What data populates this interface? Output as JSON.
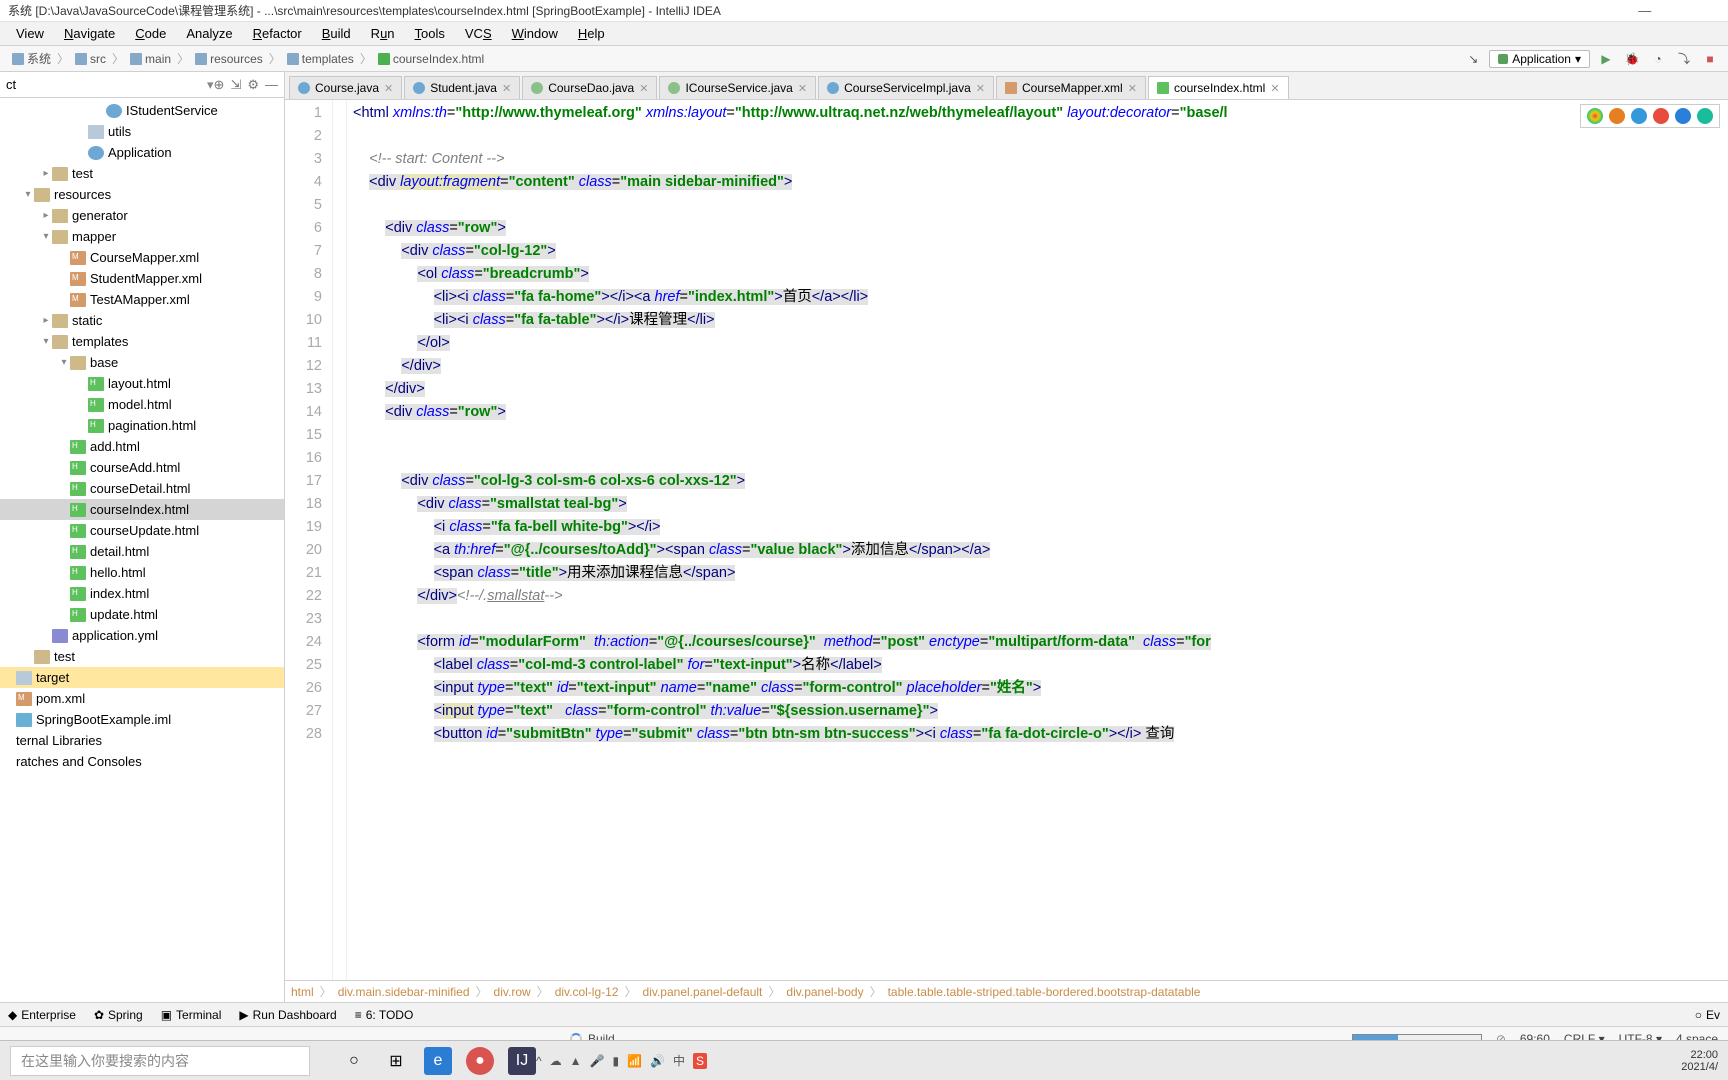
{
  "window": {
    "title": "系统 [D:\\Java\\JavaSourceCode\\课程管理系统] - ...\\src\\main\\resources\\templates\\courseIndex.html [SpringBootExample] - IntelliJ IDEA"
  },
  "menu": {
    "view": "View",
    "navigate": "Navigate",
    "code": "Code",
    "analyze": "Analyze",
    "refactor": "Refactor",
    "build": "Build",
    "run": "Run",
    "tools": "Tools",
    "vcs": "VCS",
    "window": "Window",
    "help": "Help"
  },
  "breadcrumbs": {
    "items": [
      "系统",
      "src",
      "main",
      "resources",
      "templates",
      "courseIndex.html"
    ]
  },
  "runConfig": {
    "name": "Application"
  },
  "projectHeader": {
    "title": "ct"
  },
  "tree": [
    {
      "indent": 5,
      "icon": "class",
      "label": "IStudentService"
    },
    {
      "indent": 4,
      "icon": "folder",
      "label": "utils"
    },
    {
      "indent": 4,
      "icon": "class",
      "label": "Application"
    },
    {
      "indent": 2,
      "arrow": "▸",
      "icon": "folder-res",
      "label": "test"
    },
    {
      "indent": 1,
      "arrow": "▾",
      "icon": "folder-res",
      "label": "resources"
    },
    {
      "indent": 2,
      "arrow": "▸",
      "icon": "folder-res",
      "label": "generator"
    },
    {
      "indent": 2,
      "arrow": "▾",
      "icon": "folder-res",
      "label": "mapper"
    },
    {
      "indent": 3,
      "icon": "xml",
      "label": "CourseMapper.xml"
    },
    {
      "indent": 3,
      "icon": "xml",
      "label": "StudentMapper.xml"
    },
    {
      "indent": 3,
      "icon": "xml",
      "label": "TestAMapper.xml"
    },
    {
      "indent": 2,
      "arrow": "▸",
      "icon": "folder-res",
      "label": "static"
    },
    {
      "indent": 2,
      "arrow": "▾",
      "icon": "folder-res",
      "label": "templates"
    },
    {
      "indent": 3,
      "arrow": "▾",
      "icon": "folder-res",
      "label": "base"
    },
    {
      "indent": 4,
      "icon": "html",
      "label": "layout.html"
    },
    {
      "indent": 4,
      "icon": "html",
      "label": "model.html"
    },
    {
      "indent": 4,
      "icon": "html",
      "label": "pagination.html"
    },
    {
      "indent": 3,
      "icon": "html",
      "label": "add.html"
    },
    {
      "indent": 3,
      "icon": "html",
      "label": "courseAdd.html"
    },
    {
      "indent": 3,
      "icon": "html",
      "label": "courseDetail.html"
    },
    {
      "indent": 3,
      "icon": "html",
      "label": "courseIndex.html",
      "selected": true
    },
    {
      "indent": 3,
      "icon": "html",
      "label": "courseUpdate.html"
    },
    {
      "indent": 3,
      "icon": "html",
      "label": "detail.html"
    },
    {
      "indent": 3,
      "icon": "html",
      "label": "hello.html"
    },
    {
      "indent": 3,
      "icon": "html",
      "label": "index.html"
    },
    {
      "indent": 3,
      "icon": "html",
      "label": "update.html"
    },
    {
      "indent": 2,
      "icon": "yml",
      "label": "application.yml"
    },
    {
      "indent": 1,
      "icon": "folder-res",
      "label": "test"
    },
    {
      "indent": 0,
      "icon": "folder",
      "label": "target",
      "highlighted": true
    },
    {
      "indent": 0,
      "icon": "xml",
      "label": "pom.xml"
    },
    {
      "indent": 0,
      "icon": "iml",
      "label": "SpringBootExample.iml"
    },
    {
      "indent": 0,
      "label": "ternal Libraries"
    },
    {
      "indent": 0,
      "label": "ratches and Consoles"
    }
  ],
  "tabs": [
    {
      "icon": "java",
      "label": "Course.java"
    },
    {
      "icon": "java",
      "label": "Student.java"
    },
    {
      "icon": "iface",
      "label": "CourseDao.java"
    },
    {
      "icon": "iface",
      "label": "ICourseService.java"
    },
    {
      "icon": "java",
      "label": "CourseServiceImpl.java"
    },
    {
      "icon": "xml",
      "label": "CourseMapper.xml"
    },
    {
      "icon": "html",
      "label": "courseIndex.html",
      "active": true
    }
  ],
  "code": {
    "lines": [
      1,
      2,
      3,
      4,
      5,
      6,
      7,
      8,
      9,
      10,
      11,
      12,
      13,
      14,
      15,
      16,
      17,
      18,
      19,
      20,
      21,
      22,
      23,
      24,
      25,
      26,
      27,
      28
    ]
  },
  "breadcrumbs2": [
    "html",
    "div.main.sidebar-minified",
    "div.row",
    "div.col-lg-12",
    "div.panel.panel-default",
    "div.panel-body",
    "table.table.table-striped.table-bordered.bootstrap-datatable"
  ],
  "bottomTools": {
    "enterprise": "Enterprise",
    "spring": "Spring",
    "terminal": "Terminal",
    "runDashboard": "Run Dashboard",
    "todo": "6: TODO",
    "eventLog": "Ev"
  },
  "status": {
    "build": "Build",
    "pos": "69:60",
    "crlf": "CRLF",
    "enc": "UTF-8",
    "indent": "4 space"
  },
  "taskbar": {
    "search": "在这里输入你要搜索的内容",
    "time": "22:00",
    "date": "2021/4/"
  }
}
